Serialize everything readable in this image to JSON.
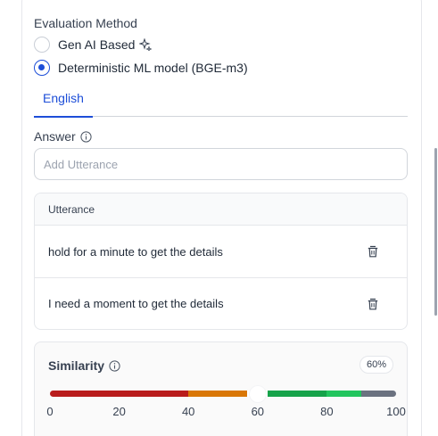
{
  "evaluation": {
    "title": "Evaluation Method",
    "options": [
      {
        "label": "Gen AI Based",
        "checked": false
      },
      {
        "label": "Deterministic ML model (BGE-m3)",
        "checked": true
      }
    ]
  },
  "tabs": [
    {
      "label": "English",
      "active": true
    }
  ],
  "answer": {
    "label": "Answer",
    "input_placeholder": "Add Utterance",
    "input_value": ""
  },
  "utterance_table": {
    "header": "Utterance",
    "rows": [
      {
        "text": "hold for a minute to get the details"
      },
      {
        "text": "I need a moment to get the details"
      }
    ]
  },
  "similarity": {
    "title": "Similarity",
    "badge": "60%",
    "value_percent": 60,
    "ticks": [
      "0",
      "20",
      "40",
      "60",
      "80",
      "100"
    ],
    "segments": [
      {
        "from": 0,
        "to": 40,
        "color": "#b91c1c"
      },
      {
        "from": 40,
        "to": 57,
        "color": "#d97706"
      },
      {
        "from": 57,
        "to": 63,
        "color": "#ffffff"
      },
      {
        "from": 63,
        "to": 80,
        "color": "#16a34a"
      },
      {
        "from": 80,
        "to": 90,
        "color": "#22c55e"
      },
      {
        "from": 90,
        "to": 100,
        "color": "#6b7280"
      }
    ]
  },
  "colors": {
    "accent": "#1d4ed8"
  }
}
